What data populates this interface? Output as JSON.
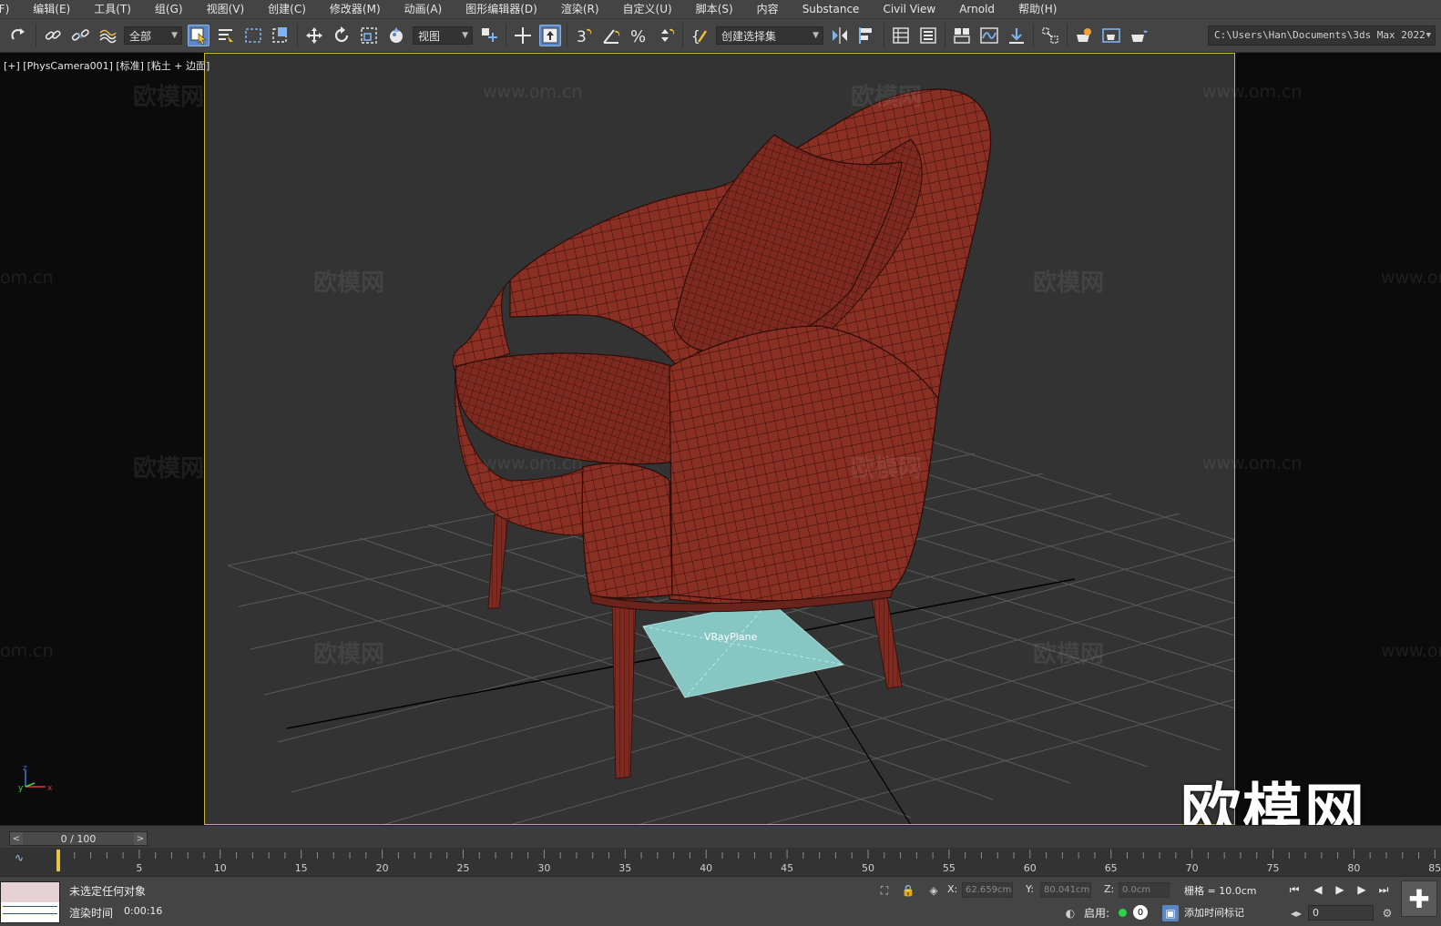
{
  "menu": [
    "(F)",
    "编辑(E)",
    "工具(T)",
    "组(G)",
    "视图(V)",
    "创建(C)",
    "修改器(M)",
    "动画(A)",
    "图形编辑器(D)",
    "渲染(R)",
    "自定义(U)",
    "脚本(S)",
    "内容",
    "Substance",
    "Civil View",
    "Arnold",
    "帮助(H)"
  ],
  "toolbar": {
    "selection_filter": "全部",
    "ref_coord": "视图",
    "named_selection": "创建选择集",
    "path": "C:\\Users\\Han\\Documents\\3ds Max 2022",
    "snap_label": "3"
  },
  "viewport": {
    "label": "[+] [PhysCamera001] [标准] [粘土 + 边面]",
    "object_label": "VRayPlane",
    "watermark_text": "欧模网",
    "watermark_url": "www.om.cn",
    "watermark_url_partial": "om.cn",
    "watermark_big": "欧模网",
    "axis_x": "x",
    "axis_y": "y",
    "axis_z": "z"
  },
  "timeline": {
    "slider_text": "0 / 100",
    "ticks": [
      "5",
      "10",
      "15",
      "20",
      "25",
      "30",
      "35",
      "40",
      "45",
      "50",
      "55",
      "60",
      "65",
      "70",
      "75",
      "80",
      "85"
    ]
  },
  "status": {
    "selection": "未选定任何对象",
    "render_time_label": "渲染时间",
    "render_time": "0:00:16",
    "x_label": "X:",
    "x_value": "62.659cm",
    "y_label": "Y:",
    "y_value": "80.041cm",
    "z_label": "Z:",
    "z_value": "0.0cm",
    "grid": "栅格 = 10.0cm",
    "enable_label": "启用:",
    "enable_value": "0",
    "add_time_tag": "添加时间标记",
    "frame_value": "0"
  },
  "colors": {
    "chair": "#8a2f24",
    "vray_plane": "#86c6c3",
    "safe_frame": "#c9b43a",
    "active_button": "#5b88c4"
  }
}
